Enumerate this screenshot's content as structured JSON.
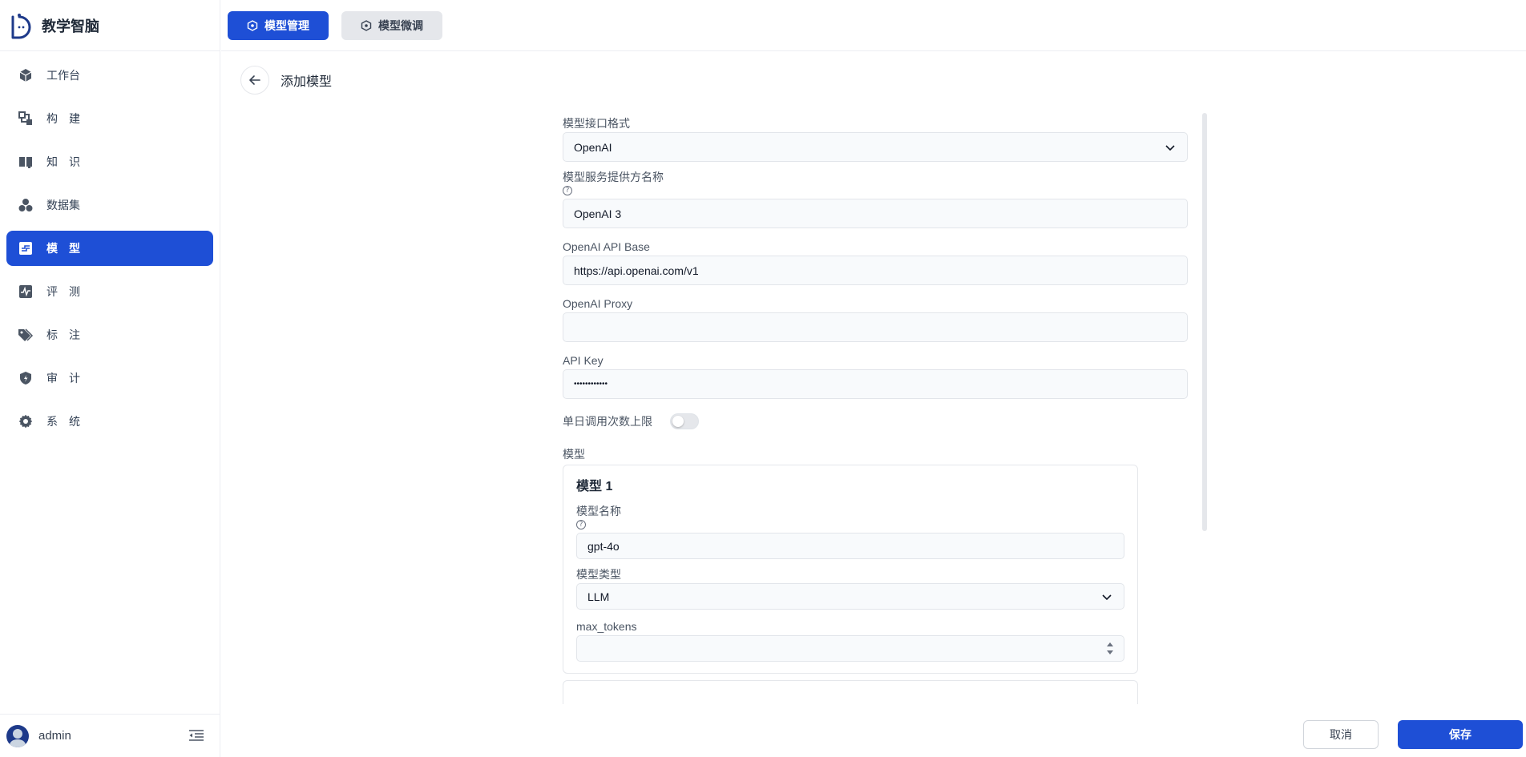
{
  "app": {
    "name": "教学智脑"
  },
  "sidebar": {
    "items": [
      {
        "label": "工作台",
        "icon": "cube-icon",
        "active": false
      },
      {
        "label": "构　建",
        "icon": "build-icon",
        "active": false
      },
      {
        "label": "知　识",
        "icon": "book-icon",
        "active": false
      },
      {
        "label": "数据集",
        "icon": "dataset-icon",
        "active": false
      },
      {
        "label": "模　型",
        "icon": "model-icon",
        "active": true
      },
      {
        "label": "评　测",
        "icon": "pulse-icon",
        "active": false
      },
      {
        "label": "标　注",
        "icon": "tag-icon",
        "active": false
      },
      {
        "label": "审　计",
        "icon": "shield-icon",
        "active": false
      },
      {
        "label": "系　统",
        "icon": "gear-icon",
        "active": false
      }
    ],
    "user": "admin"
  },
  "topbar": {
    "tabs": [
      {
        "label": "模型管理",
        "active": true
      },
      {
        "label": "模型微调",
        "active": false
      }
    ]
  },
  "page": {
    "title": "添加模型"
  },
  "form": {
    "interface_label": "模型接口格式",
    "interface_value": "OpenAI",
    "provider_label": "模型服务提供方名称",
    "provider_value": "OpenAI 3",
    "api_base_label": "OpenAI API Base",
    "api_base_value": "https://api.openai.com/v1",
    "proxy_label": "OpenAI Proxy",
    "proxy_value": "",
    "api_key_label": "API Key",
    "api_key_value": "••••••••••••",
    "daily_limit_label": "单日调用次数上限",
    "daily_limit_enabled": false,
    "models_label": "模型",
    "models": [
      {
        "title": "模型 1",
        "name_label": "模型名称",
        "name_value": "gpt-4o",
        "type_label": "模型类型",
        "type_value": "LLM",
        "max_tokens_label": "max_tokens",
        "max_tokens_value": ""
      }
    ]
  },
  "actions": {
    "cancel": "取消",
    "save": "保存"
  },
  "colors": {
    "primary": "#1e4fd6",
    "tab_inactive_bg": "#e5e7eb"
  }
}
